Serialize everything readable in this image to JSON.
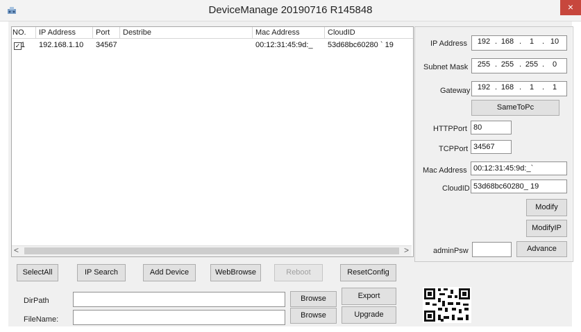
{
  "window": {
    "title": "DeviceManage 20190716 R145848",
    "close_glyph": "×"
  },
  "table": {
    "headers": [
      "NO.",
      "IP Address",
      "Port",
      "Destribe",
      "Mac Address",
      "CloudID"
    ],
    "rows": [
      {
        "checked": true,
        "check_glyph": "✓",
        "no": "1",
        "ip": "192.168.1.10",
        "port": "34567",
        "describe": "",
        "mac": "00:12:31:45:9d:_",
        "cloudid": "53d68bc60280 ` 19"
      }
    ]
  },
  "scroll": {
    "left_arrow": "<",
    "right_arrow": ">"
  },
  "network": {
    "ip_label": "IP Address",
    "ip": [
      "192",
      "168",
      "1",
      "10"
    ],
    "mask_label": "Subnet Mask",
    "mask": [
      "255",
      "255",
      "255",
      "0"
    ],
    "gateway_label": "Gateway",
    "gateway": [
      "192",
      "168",
      "1",
      "1"
    ],
    "dot": ".",
    "same_to_pc": "SameToPc",
    "http_label": "HTTPPort",
    "http_port": "80",
    "tcp_label": "TCPPort",
    "tcp_port": "34567",
    "mac_label": "Mac Address",
    "mac": "00:12:31:45:9d:_`",
    "cloud_label": "CloudID",
    "cloudid": "53d68bc60280_ 19",
    "modify": "Modify",
    "modify_ip": "ModifyIP",
    "admin_label": "adminPsw",
    "admin_psw": "",
    "advance": "Advance"
  },
  "actions": {
    "select_all": "SelectAll",
    "ip_search": "IP Search",
    "add_device": "Add Device",
    "web_browse": "WebBrowse",
    "reboot": "Reboot",
    "reset_config": "ResetConfig"
  },
  "files": {
    "dir_label": "DirPath",
    "dir_value": "",
    "file_label": "FileName:",
    "file_value": "",
    "browse1": "Browse",
    "export": "Export",
    "browse2": "Browse",
    "upgrade": "Upgrade"
  }
}
